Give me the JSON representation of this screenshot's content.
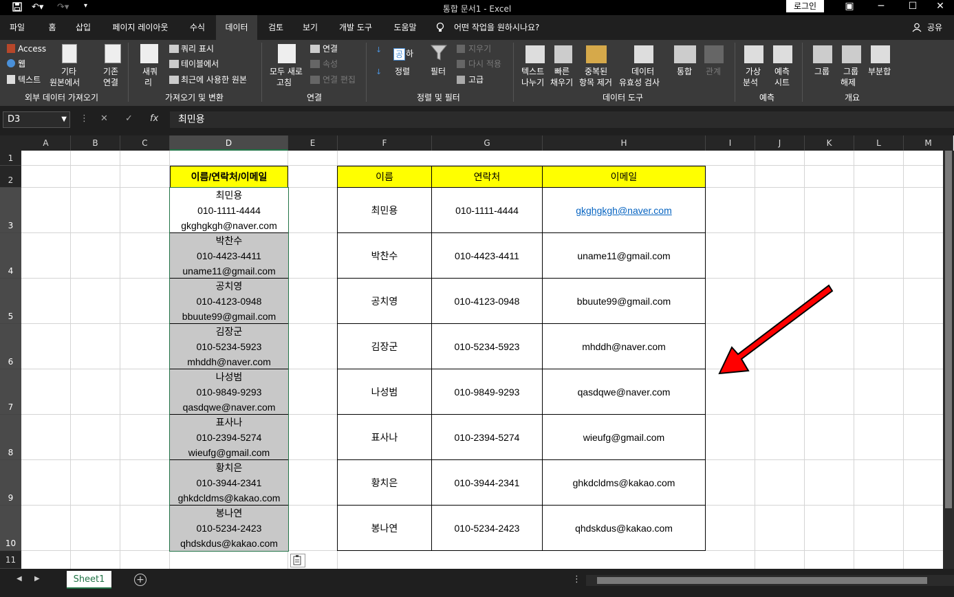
{
  "window": {
    "title": "통합 문서1  -  Excel",
    "login": "로그인"
  },
  "tabs": [
    "파일",
    "홈",
    "삽입",
    "페이지 레이아웃",
    "수식",
    "데이터",
    "검토",
    "보기",
    "개발 도구",
    "도움말"
  ],
  "tell_me": "어떤 작업을 원하시나요?",
  "share": "공유",
  "ribbon": {
    "get_external": {
      "access": "Access",
      "web": "웹",
      "text": "텍스트",
      "other1": "기타",
      "other2": "원본에서",
      "existing1": "기존",
      "existing2": "연결",
      "group": "외부 데이터 가져오기"
    },
    "get_transform": {
      "new_query1": "새쿼",
      "new_query2": "리",
      "show_queries": "쿼리 표시",
      "from_table": "테이블에서",
      "recent": "최근에 사용한 원본",
      "group": "가져오기 및 변환"
    },
    "connections": {
      "refresh1": "모두 새로",
      "refresh2": "고침",
      "connections": "연결",
      "properties": "속성",
      "edit_links": "연결 편집",
      "group": "연결"
    },
    "sort_filter": {
      "sort": "정렬",
      "filter": "필터",
      "clear": "지우기",
      "reapply": "다시 적용",
      "advanced": "고급",
      "az": "공",
      "za": "하",
      "group": "정렬 및 필터"
    },
    "data_tools": {
      "text_cols1": "텍스트",
      "text_cols2": "나누기",
      "flash1": "빠른",
      "flash2": "채우기",
      "dup1": "중복된",
      "dup2": "항목 제거",
      "valid1": "데이터",
      "valid2": "유효성 검사",
      "consolidate": "통합",
      "relations": "관계",
      "group": "데이터 도구"
    },
    "forecast": {
      "whatif1": "가상",
      "whatif2": "분석",
      "sheet1": "예측",
      "sheet2": "시트",
      "group": "예측"
    },
    "outline": {
      "group_btn": "그룹",
      "ungroup1": "그룹",
      "ungroup2": "해제",
      "subtotal": "부분합",
      "group": "개요"
    }
  },
  "formula_bar": {
    "name_box": "D3",
    "content": "최민용"
  },
  "columns": [
    "A",
    "B",
    "C",
    "D",
    "E",
    "F",
    "G",
    "H",
    "I",
    "J",
    "K",
    "L",
    "M"
  ],
  "rows": [
    "1",
    "2",
    "3",
    "4",
    "5",
    "6",
    "7",
    "8",
    "9",
    "10",
    "11"
  ],
  "combined_header": "이름/연락처/이메일",
  "table_headers": {
    "name": "이름",
    "phone": "연락처",
    "email": "이메일"
  },
  "people": [
    {
      "name": "최민용",
      "phone": "010-1111-4444",
      "email": "gkghgkgh@naver.com"
    },
    {
      "name": "박찬수",
      "phone": "010-4423-4411",
      "email": "uname11@gmail.com"
    },
    {
      "name": "공치영",
      "phone": "010-4123-0948",
      "email": "bbuute99@gmail.com"
    },
    {
      "name": "김장군",
      "phone": "010-5234-5923",
      "email": "mhddh@naver.com"
    },
    {
      "name": "나성범",
      "phone": "010-9849-9293",
      "email": "qasdqwe@naver.com"
    },
    {
      "name": "표사나",
      "phone": "010-2394-5274",
      "email": "wieufg@gmail.com"
    },
    {
      "name": "황치은",
      "phone": "010-3944-2341",
      "email": "ghkdcldms@kakao.com"
    },
    {
      "name": "봉나연",
      "phone": "010-5234-2423",
      "email": "qhdskdus@kakao.com"
    }
  ],
  "sheet_tab": "Sheet1",
  "colors": {
    "accent": "#217346",
    "header_yellow": "#ffff00",
    "arrow_red": "#ff0000",
    "link_blue": "#0563c1"
  }
}
